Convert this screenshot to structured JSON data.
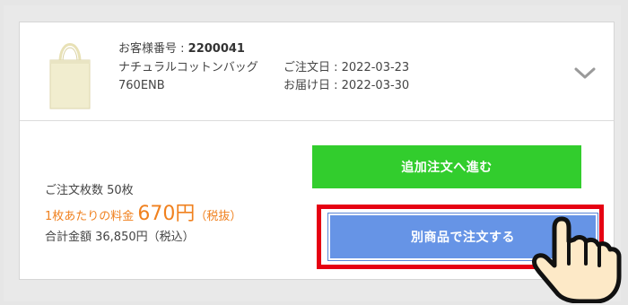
{
  "order": {
    "customer_label": "お客様番号 : ",
    "customer_number": "2200041",
    "product_name": "ナチュラルコットンバッグ",
    "product_code": "760ENB",
    "order_date": "ご注文日 : 2022-03-23",
    "delivery_date": "お届け日 : 2022-03-30",
    "product_image": "cotton-tote-bag",
    "expand_icon": "chevron-down-icon"
  },
  "summary": {
    "quantity_text": "ご注文枚数 50枚",
    "unit_price_label": "1枚あたりの料金",
    "unit_price_value": "670円",
    "unit_price_tax": "（税抜）",
    "total_text": "合計金額 36,850円（税込）"
  },
  "buttons": {
    "reorder_label": "追加注文へ進む",
    "other_product_label": "別商品で注文する"
  },
  "colors": {
    "reorder": "#32cd2d",
    "other_product": "#6694e6",
    "highlight": "#e60012",
    "price": "#f0811f"
  },
  "pointer_icon": "pointing-hand-icon"
}
